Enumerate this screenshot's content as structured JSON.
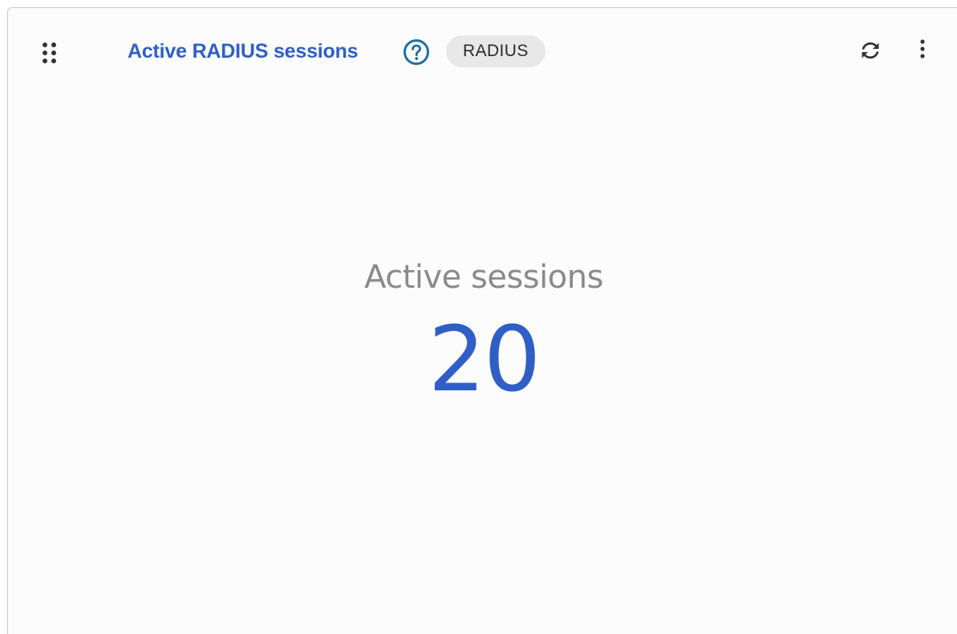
{
  "widget": {
    "title": "Active RADIUS sessions",
    "badge": "RADIUS",
    "icons": {
      "drag": "drag-handle-icon",
      "help": "help-circle-icon",
      "refresh": "refresh-icon",
      "menu": "more-vertical-icon"
    },
    "metric": {
      "label": "Active sessions",
      "value": "20"
    }
  },
  "colors": {
    "accent": "#2f5fc6",
    "help_icon": "#1f6fa0",
    "badge_bg": "#e8e8e8",
    "muted_text": "#8a8a8a",
    "panel_bg": "#fcfcfc"
  }
}
